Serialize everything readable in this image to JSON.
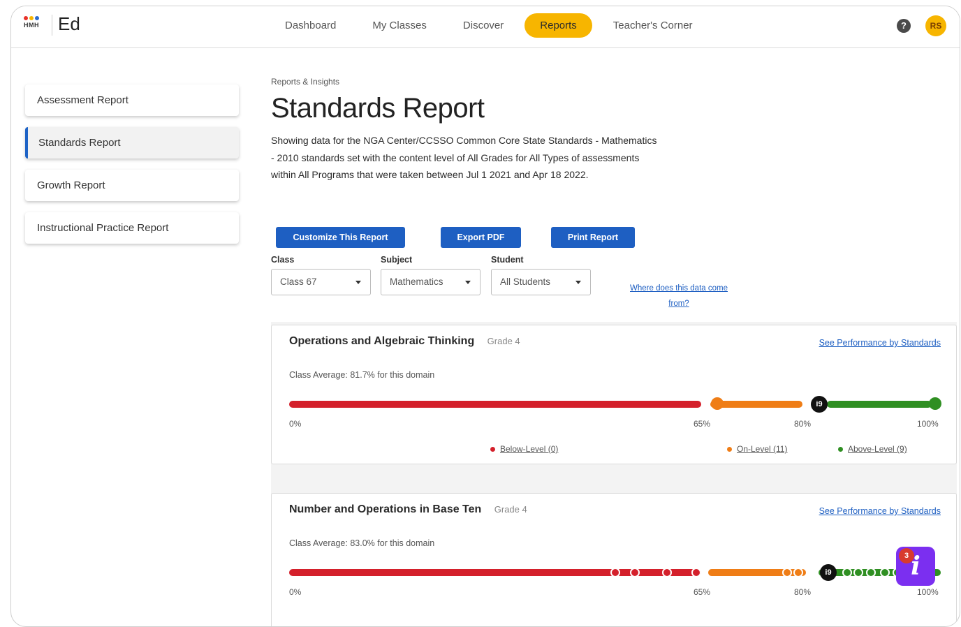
{
  "header": {
    "logo_text": "HMH",
    "app_name": "Ed",
    "nav": [
      {
        "label": "Dashboard"
      },
      {
        "label": "My Classes"
      },
      {
        "label": "Discover"
      },
      {
        "label": "Reports"
      },
      {
        "label": "Teacher's Corner"
      }
    ],
    "active_nav": "Reports",
    "help_icon": "?",
    "avatar_initials": "RS"
  },
  "sidebar": {
    "items": [
      {
        "label": "Assessment Report"
      },
      {
        "label": "Standards Report"
      },
      {
        "label": "Growth Report"
      },
      {
        "label": "Instructional Practice Report"
      }
    ],
    "active_item": "Standards Report"
  },
  "main": {
    "breadcrumb": "Reports & Insights",
    "title": "Standards Report",
    "description": "Showing data for the NGA Center/CCSSO Common Core State Standards - Mathematics - 2010 standards set with the content level of All Grades for All Types of assessments within All Programs that were taken between Jul 1 2021 and Apr 18 2022.",
    "buttons": {
      "customize": "Customize This Report",
      "export": "Export PDF",
      "print": "Print Report"
    },
    "filters": {
      "class_label": "Class",
      "class_value": "Class 67",
      "subject_label": "Subject",
      "subject_value": "Mathematics",
      "student_label": "Student",
      "student_value": "All Students"
    },
    "data_source_link": "Where does this data come from?"
  },
  "domains": [
    {
      "title": "Operations and Algebraic Thinking",
      "grade": "Grade 4",
      "link": "See Performance by Standards",
      "average_text": "Class Average: 81.7% for this domain",
      "class_average_pct": 81.7,
      "marker_label": "i9",
      "ticks": [
        "0%",
        "65%",
        "80%",
        "100%"
      ],
      "legend": {
        "below": "Below-Level (0)",
        "on": "On-Level (11)",
        "above": "Above-Level (9)"
      }
    },
    {
      "title": "Number and Operations in Base Ten",
      "grade": "Grade 4",
      "link": "See Performance by Standards",
      "average_text": "Class Average: 83.0% for this domain",
      "class_average_pct": 83.0,
      "marker_label": "i9",
      "ticks": [
        "0%",
        "65%",
        "80%",
        "100%"
      ]
    }
  ],
  "assistant": {
    "icon": "i",
    "badge": "3"
  },
  "colors": {
    "below": "#d4202b",
    "on": "#ef7d16",
    "above": "#2f8f22",
    "accent": "#f7b500",
    "primary": "#1e5fc2"
  }
}
